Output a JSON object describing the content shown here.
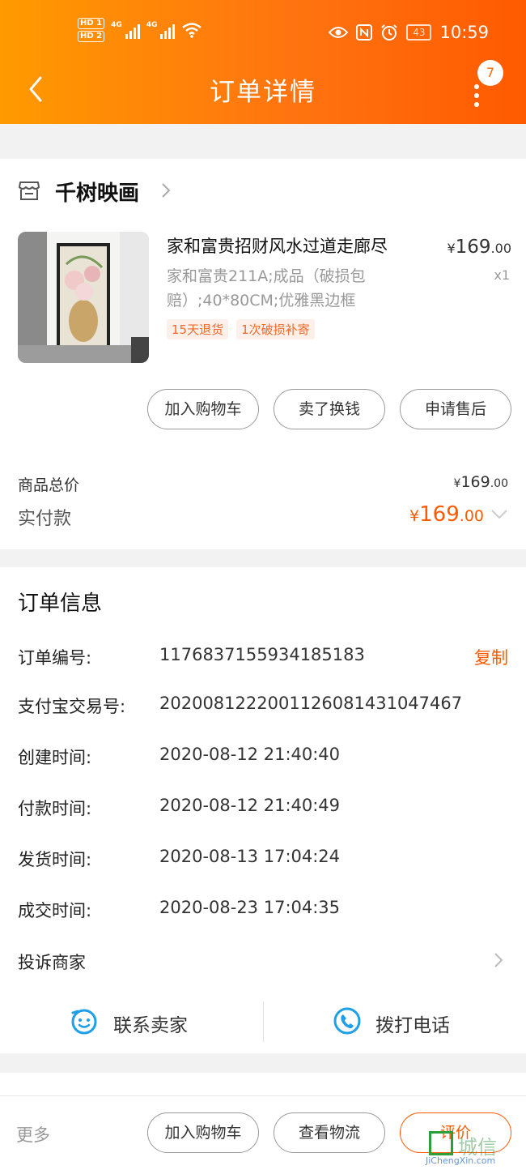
{
  "status_bar": {
    "hd1": "HD 1",
    "hd2": "HD 2",
    "net1": "4G",
    "net2": "4G",
    "battery": "43",
    "time": "10:59"
  },
  "header": {
    "title": "订单详情",
    "badge_count": "7"
  },
  "shop": {
    "name": "千树映画"
  },
  "product": {
    "title": "家和富贵招财风水过道走廊尽",
    "price_symbol": "¥",
    "price_int": "169",
    "price_dec": ".00",
    "spec": "家和富贵211A;成品（破损包赔）;40*80CM;优雅黑边框",
    "quantity": "x1",
    "tags": [
      "15天退货",
      "1次破损补寄"
    ]
  },
  "actions": {
    "add_to_cart": "加入购物车",
    "sell_for_cash": "卖了换钱",
    "after_sales": "申请售后"
  },
  "summary": {
    "total_label": "商品总价",
    "total_symbol": "¥",
    "total_int": "169",
    "total_dec": ".00",
    "paid_label": "实付款",
    "paid_symbol": "¥",
    "paid_int": "169",
    "paid_dec": ".00"
  },
  "order_info": {
    "title": "订单信息",
    "copy_label": "复制",
    "rows": [
      {
        "label": "订单编号:",
        "value": "1176837155934185183"
      },
      {
        "label": "支付宝交易号:",
        "value": "2020081222001126081431047467"
      },
      {
        "label": "创建时间:",
        "value": "2020-08-12 21:40:40"
      },
      {
        "label": "付款时间:",
        "value": "2020-08-12 21:40:49"
      },
      {
        "label": "发货时间:",
        "value": "2020-08-13 17:04:24"
      },
      {
        "label": "成交时间:",
        "value": "2020-08-23 17:04:35"
      }
    ],
    "complain_label": "投诉商家",
    "contact_seller": "联系卖家",
    "call_phone": "拨打电话"
  },
  "bottom_bar": {
    "more": "更多",
    "add_to_cart": "加入购物车",
    "view_logistics": "查看物流",
    "review": "评价"
  },
  "watermark": {
    "text": "城信",
    "url": "JiChengXin.com"
  },
  "colors": {
    "accent": "#ff5a00",
    "header_start": "#ff9a00",
    "header_end": "#ff5a00",
    "tag_bg": "#fdf0ea",
    "tag_text": "#f06a2a"
  }
}
